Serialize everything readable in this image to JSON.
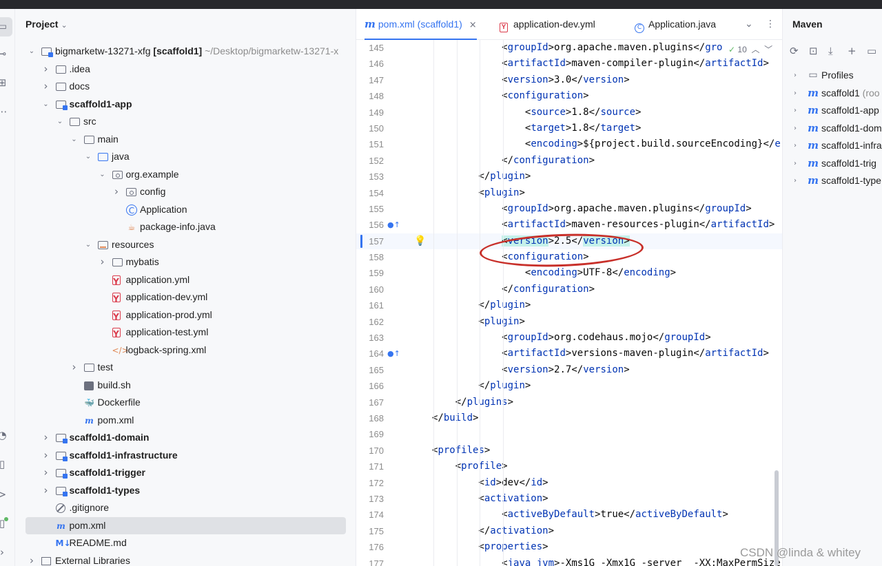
{
  "project_panel": {
    "title": "Project",
    "tree": [
      {
        "depth": 0,
        "arrow": "down",
        "icon": "module",
        "label": "bigmarketw-13271-xfg",
        "suffix": "[scaffold1]",
        "hint": "~/Desktop/bigmarketw-13271-x",
        "bold": false
      },
      {
        "depth": 1,
        "arrow": "right",
        "icon": "folder",
        "label": ".idea"
      },
      {
        "depth": 1,
        "arrow": "right",
        "icon": "folder",
        "label": "docs"
      },
      {
        "depth": 1,
        "arrow": "down",
        "icon": "module",
        "label": "scaffold1-app",
        "bold": true
      },
      {
        "depth": 2,
        "arrow": "down",
        "icon": "folder",
        "label": "src"
      },
      {
        "depth": 3,
        "arrow": "down",
        "icon": "folder",
        "label": "main"
      },
      {
        "depth": 4,
        "arrow": "down",
        "icon": "src",
        "label": "java"
      },
      {
        "depth": 5,
        "arrow": "down",
        "icon": "package",
        "label": "org.example"
      },
      {
        "depth": 6,
        "arrow": "right",
        "icon": "package",
        "label": "config"
      },
      {
        "depth": 6,
        "arrow": "",
        "icon": "class",
        "label": "Application"
      },
      {
        "depth": 6,
        "arrow": "",
        "icon": "pkginfo",
        "label": "package-info.java"
      },
      {
        "depth": 4,
        "arrow": "down",
        "icon": "resources",
        "label": "resources"
      },
      {
        "depth": 5,
        "arrow": "right",
        "icon": "folder",
        "label": "mybatis"
      },
      {
        "depth": 5,
        "arrow": "",
        "icon": "yml",
        "label": "application.yml"
      },
      {
        "depth": 5,
        "arrow": "",
        "icon": "yml",
        "label": "application-dev.yml"
      },
      {
        "depth": 5,
        "arrow": "",
        "icon": "yml",
        "label": "application-prod.yml"
      },
      {
        "depth": 5,
        "arrow": "",
        "icon": "yml",
        "label": "application-test.yml"
      },
      {
        "depth": 5,
        "arrow": "",
        "icon": "xml",
        "label": "logback-spring.xml"
      },
      {
        "depth": 3,
        "arrow": "right",
        "icon": "folder",
        "label": "test"
      },
      {
        "depth": 3,
        "arrow": "",
        "icon": "sh",
        "label": "build.sh"
      },
      {
        "depth": 3,
        "arrow": "",
        "icon": "docker",
        "label": "Dockerfile"
      },
      {
        "depth": 3,
        "arrow": "",
        "icon": "maven",
        "label": "pom.xml"
      },
      {
        "depth": 1,
        "arrow": "right",
        "icon": "module",
        "label": "scaffold1-domain",
        "bold": true
      },
      {
        "depth": 1,
        "arrow": "right",
        "icon": "module",
        "label": "scaffold1-infrastructure",
        "bold": true
      },
      {
        "depth": 1,
        "arrow": "right",
        "icon": "module",
        "label": "scaffold1-trigger",
        "bold": true
      },
      {
        "depth": 1,
        "arrow": "right",
        "icon": "module",
        "label": "scaffold1-types",
        "bold": true
      },
      {
        "depth": 1,
        "arrow": "",
        "icon": "git",
        "label": ".gitignore"
      },
      {
        "depth": 1,
        "arrow": "",
        "icon": "maven",
        "label": "pom.xml",
        "selected": true
      },
      {
        "depth": 1,
        "arrow": "",
        "icon": "md",
        "label": "README.md"
      },
      {
        "depth": 0,
        "arrow": "right",
        "icon": "lib",
        "label": "External Libraries"
      }
    ]
  },
  "editor": {
    "tabs": [
      {
        "icon": "maven",
        "label": "pom.xml (scaffold1)",
        "active": true,
        "closable": true
      },
      {
        "icon": "yml",
        "label": "application-dev.yml",
        "active": false
      },
      {
        "icon": "class",
        "label": "Application.java",
        "active": false
      }
    ],
    "inspection_count": "10",
    "current_line": 157,
    "lines": [
      {
        "n": 145,
        "indent": 3,
        "parts": [
          [
            "t",
            "<"
          ],
          [
            "k",
            "groupId"
          ],
          [
            "t",
            ">org.apache.maven.plugins</"
          ],
          [
            "k",
            "gro"
          ]
        ]
      },
      {
        "n": 146,
        "indent": 3,
        "parts": [
          [
            "t",
            "<"
          ],
          [
            "k",
            "artifactId"
          ],
          [
            "t",
            ">maven-compiler-plugin</"
          ],
          [
            "k",
            "artifactId"
          ],
          [
            "t",
            ">"
          ]
        ]
      },
      {
        "n": 147,
        "indent": 3,
        "parts": [
          [
            "t",
            "<"
          ],
          [
            "k",
            "version"
          ],
          [
            "t",
            ">3.0</"
          ],
          [
            "k",
            "version"
          ],
          [
            "t",
            ">"
          ]
        ]
      },
      {
        "n": 148,
        "indent": 3,
        "parts": [
          [
            "t",
            "<"
          ],
          [
            "k",
            "configuration"
          ],
          [
            "t",
            ">"
          ]
        ]
      },
      {
        "n": 149,
        "indent": 4,
        "parts": [
          [
            "t",
            "<"
          ],
          [
            "k",
            "source"
          ],
          [
            "t",
            ">1.8</"
          ],
          [
            "k",
            "source"
          ],
          [
            "t",
            ">"
          ]
        ]
      },
      {
        "n": 150,
        "indent": 4,
        "parts": [
          [
            "t",
            "<"
          ],
          [
            "k",
            "target"
          ],
          [
            "t",
            ">1.8</"
          ],
          [
            "k",
            "target"
          ],
          [
            "t",
            ">"
          ]
        ]
      },
      {
        "n": 151,
        "indent": 4,
        "parts": [
          [
            "t",
            "<"
          ],
          [
            "k",
            "encoding"
          ],
          [
            "t",
            ">${project.build.sourceEncoding}</"
          ],
          [
            "k",
            "e"
          ]
        ]
      },
      {
        "n": 152,
        "indent": 3,
        "parts": [
          [
            "t",
            "</"
          ],
          [
            "k",
            "configuration"
          ],
          [
            "t",
            ">"
          ]
        ]
      },
      {
        "n": 153,
        "indent": 2,
        "parts": [
          [
            "t",
            "</"
          ],
          [
            "k",
            "plugin"
          ],
          [
            "t",
            ">"
          ]
        ]
      },
      {
        "n": 154,
        "indent": 2,
        "parts": [
          [
            "t",
            "<"
          ],
          [
            "k",
            "plugin"
          ],
          [
            "t",
            ">"
          ]
        ]
      },
      {
        "n": 155,
        "indent": 3,
        "parts": [
          [
            "t",
            "<"
          ],
          [
            "k",
            "groupId"
          ],
          [
            "t",
            ">org.apache.maven.plugins</"
          ],
          [
            "k",
            "groupId"
          ],
          [
            "t",
            ">"
          ]
        ]
      },
      {
        "n": 156,
        "indent": 3,
        "gutter": "override",
        "parts": [
          [
            "t",
            "<"
          ],
          [
            "k",
            "artifactId"
          ],
          [
            "t",
            ">maven-resources-plugin</"
          ],
          [
            "k",
            "artifactId"
          ],
          [
            "t",
            ">"
          ]
        ]
      },
      {
        "n": 157,
        "indent": 3,
        "bulb": true,
        "parts": [
          [
            "h",
            "<"
          ],
          [
            "hk",
            "version"
          ],
          [
            "t",
            ">2.5</"
          ],
          [
            "hk",
            "version"
          ],
          [
            "h",
            ">"
          ]
        ]
      },
      {
        "n": 158,
        "indent": 3,
        "parts": [
          [
            "t",
            "<"
          ],
          [
            "k",
            "configuration"
          ],
          [
            "t",
            ">"
          ]
        ]
      },
      {
        "n": 159,
        "indent": 4,
        "parts": [
          [
            "t",
            "<"
          ],
          [
            "k",
            "encoding"
          ],
          [
            "t",
            ">UTF-8</"
          ],
          [
            "k",
            "encoding"
          ],
          [
            "t",
            ">"
          ]
        ]
      },
      {
        "n": 160,
        "indent": 3,
        "parts": [
          [
            "t",
            "</"
          ],
          [
            "k",
            "configuration"
          ],
          [
            "t",
            ">"
          ]
        ]
      },
      {
        "n": 161,
        "indent": 2,
        "parts": [
          [
            "t",
            "</"
          ],
          [
            "k",
            "plugin"
          ],
          [
            "t",
            ">"
          ]
        ]
      },
      {
        "n": 162,
        "indent": 2,
        "parts": [
          [
            "t",
            "<"
          ],
          [
            "k",
            "plugin"
          ],
          [
            "t",
            ">"
          ]
        ]
      },
      {
        "n": 163,
        "indent": 3,
        "parts": [
          [
            "t",
            "<"
          ],
          [
            "k",
            "groupId"
          ],
          [
            "t",
            ">org.codehaus.mojo</"
          ],
          [
            "k",
            "groupId"
          ],
          [
            "t",
            ">"
          ]
        ]
      },
      {
        "n": 164,
        "indent": 3,
        "gutter": "override",
        "parts": [
          [
            "t",
            "<"
          ],
          [
            "k",
            "artifactId"
          ],
          [
            "t",
            ">versions-maven-plugin</"
          ],
          [
            "k",
            "artifactId"
          ],
          [
            "t",
            ">"
          ]
        ]
      },
      {
        "n": 165,
        "indent": 3,
        "parts": [
          [
            "t",
            "<"
          ],
          [
            "k",
            "version"
          ],
          [
            "t",
            ">2.7</"
          ],
          [
            "k",
            "version"
          ],
          [
            "t",
            ">"
          ]
        ]
      },
      {
        "n": 166,
        "indent": 2,
        "parts": [
          [
            "t",
            "</"
          ],
          [
            "k",
            "plugin"
          ],
          [
            "t",
            ">"
          ]
        ]
      },
      {
        "n": 167,
        "indent": 1,
        "parts": [
          [
            "t",
            "</"
          ],
          [
            "k",
            "plugins"
          ],
          [
            "t",
            ">"
          ]
        ]
      },
      {
        "n": 168,
        "indent": 0,
        "parts": [
          [
            "t",
            "</"
          ],
          [
            "k",
            "build"
          ],
          [
            "t",
            ">"
          ]
        ]
      },
      {
        "n": 169,
        "indent": 0,
        "parts": []
      },
      {
        "n": 170,
        "indent": 0,
        "parts": [
          [
            "t",
            "<"
          ],
          [
            "k",
            "profiles"
          ],
          [
            "t",
            ">"
          ]
        ]
      },
      {
        "n": 171,
        "indent": 1,
        "parts": [
          [
            "t",
            "<"
          ],
          [
            "k",
            "profile"
          ],
          [
            "t",
            ">"
          ]
        ]
      },
      {
        "n": 172,
        "indent": 2,
        "parts": [
          [
            "t",
            "<"
          ],
          [
            "k",
            "id"
          ],
          [
            "t",
            ">dev</"
          ],
          [
            "k",
            "id"
          ],
          [
            "t",
            ">"
          ]
        ]
      },
      {
        "n": 173,
        "indent": 2,
        "parts": [
          [
            "t",
            "<"
          ],
          [
            "k",
            "activation"
          ],
          [
            "t",
            ">"
          ]
        ]
      },
      {
        "n": 174,
        "indent": 3,
        "parts": [
          [
            "t",
            "<"
          ],
          [
            "k",
            "activeByDefault"
          ],
          [
            "t",
            ">true</"
          ],
          [
            "k",
            "activeByDefault"
          ],
          [
            "t",
            ">"
          ]
        ]
      },
      {
        "n": 175,
        "indent": 2,
        "parts": [
          [
            "t",
            "</"
          ],
          [
            "k",
            "activation"
          ],
          [
            "t",
            ">"
          ]
        ]
      },
      {
        "n": 176,
        "indent": 2,
        "parts": [
          [
            "t",
            "<"
          ],
          [
            "k",
            "properties"
          ],
          [
            "t",
            ">"
          ]
        ]
      },
      {
        "n": 177,
        "indent": 3,
        "parts": [
          [
            "t",
            "<"
          ],
          [
            "k",
            "java_jvm"
          ],
          [
            "t",
            ">-Xms1G -Xmx1G -server  -XX:MaxPermSize"
          ]
        ]
      }
    ]
  },
  "maven_panel": {
    "title": "Maven",
    "items": [
      {
        "icon": "folder",
        "label": "Profiles"
      },
      {
        "icon": "maven",
        "label": "scaffold1",
        "hint": "(roo"
      },
      {
        "icon": "maven",
        "label": "scaffold1-app"
      },
      {
        "icon": "maven",
        "label": "scaffold1-dom"
      },
      {
        "icon": "maven",
        "label": "scaffold1-infra"
      },
      {
        "icon": "maven",
        "label": "scaffold1-trig"
      },
      {
        "icon": "maven",
        "label": "scaffold1-type"
      }
    ]
  },
  "watermark": "CSDN @linda & whitey",
  "colors": {
    "accent": "#3574f0",
    "xml_tag": "#0033b3",
    "annotation": "#c8302a",
    "selection": "#dfe1e5"
  }
}
